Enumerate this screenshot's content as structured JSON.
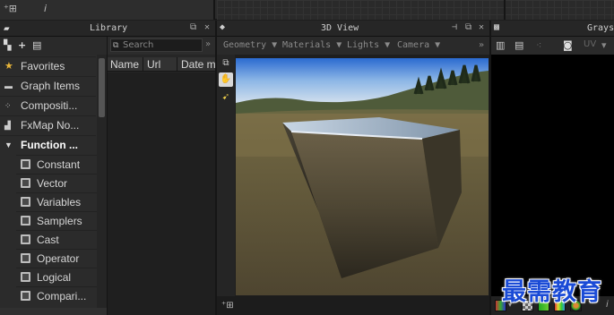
{
  "top_bar": {
    "tool_a": "⁺⊞",
    "tool_b": "i"
  },
  "library": {
    "title": "Library",
    "toolbar": {
      "folder_icon": "folder-icon",
      "add_label": "+",
      "import_icon": "import-icon"
    },
    "top_items": [
      {
        "label": "Favorites",
        "icon": "star-icon",
        "color": "#e8b53a"
      },
      {
        "label": "Graph Items",
        "icon": "graph-items-icon"
      },
      {
        "label": "Compositi...",
        "icon": "compositing-icon"
      },
      {
        "label": "FxMap No...",
        "icon": "fxmap-icon"
      },
      {
        "label": "Function ...",
        "icon": "collapse-arrow-icon"
      }
    ],
    "sub_items": [
      {
        "label": "Constant"
      },
      {
        "label": "Vector"
      },
      {
        "label": "Variables"
      },
      {
        "label": "Samplers"
      },
      {
        "label": "Cast"
      },
      {
        "label": "Operator"
      },
      {
        "label": "Logical"
      },
      {
        "label": "Compari..."
      }
    ],
    "search": {
      "placeholder": "Search",
      "more": "»"
    },
    "columns": [
      "Name",
      "Url",
      "Date m"
    ]
  },
  "view3d": {
    "title": "3D View",
    "menus": [
      "Geometry ▼",
      "Materials ▼",
      "Lights ▼",
      "Camera ▼"
    ],
    "more": "»",
    "bottom_icon": "⁺⊞"
  },
  "grayscale": {
    "title": "Graysc",
    "uv_label": "UV"
  },
  "watermark": "最需教育"
}
